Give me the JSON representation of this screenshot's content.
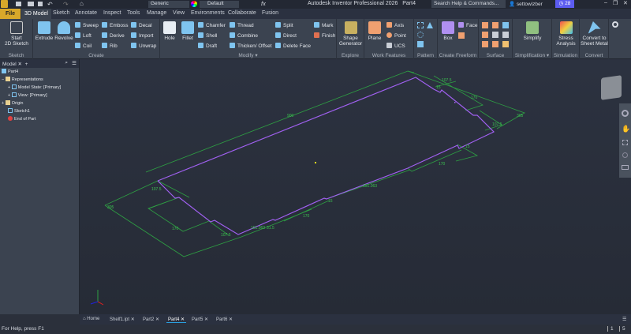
{
  "app": {
    "title": "Autodesk Inventor Professional 2026",
    "document": "Part4",
    "search_placeholder": "Search Help & Commands...",
    "user": "settowizber",
    "trial_days": "28",
    "appearance": "Generic",
    "material": "Default",
    "fx": "fx"
  },
  "tabs": [
    "File",
    "3D Model",
    "Sketch",
    "Annotate",
    "Inspect",
    "Tools",
    "Manage",
    "View",
    "Environments",
    "Collaborate",
    "Fusion"
  ],
  "ribbon": {
    "sketch": {
      "label": "Sketch",
      "start": "Start",
      "start2": "2D Sketch"
    },
    "create": {
      "label": "Create",
      "extrude": "Extrude",
      "revolve": "Revolve",
      "sweep": "Sweep",
      "loft": "Loft",
      "coil": "Coil",
      "emboss": "Emboss",
      "derive": "Derive",
      "rib": "Rib",
      "decal": "Decal",
      "import": "Import",
      "unwrap": "Unwrap"
    },
    "modify": {
      "label": "Modify ▾",
      "hole": "Hole",
      "fillet": "Fillet",
      "chamfer": "Chamfer",
      "shell": "Shell",
      "draft": "Draft",
      "thread": "Thread",
      "combine": "Combine",
      "thicken": "Thicken/ Offset",
      "split": "Split",
      "direct": "Direct",
      "delete_face": "Delete Face",
      "mark": "Mark",
      "finish": "Finish"
    },
    "explore": {
      "label": "Explore",
      "shape": "Shape",
      "generator": "Generator"
    },
    "work": {
      "label": "Work Features",
      "plane": "Plane",
      "axis": "Axis",
      "point": "Point",
      "ucs": "UCS"
    },
    "pattern": {
      "label": "Pattern"
    },
    "freeform": {
      "label": "Create Freeform",
      "box": "Box",
      "face": "Face"
    },
    "surface": {
      "label": "Surface"
    },
    "simplification": {
      "label": "Simplification ▾",
      "simplify": "Simplify"
    },
    "simulation": {
      "label": "Simulation",
      "stress": "Stress",
      "analysis": "Analysis"
    },
    "convert": {
      "label": "Convert",
      "c1": "Convert to",
      "c2": "Sheet Metal"
    }
  },
  "browser": {
    "tab": "Model",
    "items": [
      "Part4",
      "Representations",
      "Model State: [Primary]",
      "View: [Primary]",
      "Origin",
      "Sketch1",
      "End of Part"
    ]
  },
  "sketch_dims": [
    "900",
    "107.5",
    "15",
    "170",
    "305",
    "107.5",
    "15",
    "170",
    "151.063",
    "170",
    "15",
    "107.5",
    "305",
    "170",
    "107.5",
    "151.063",
    "31.5"
  ],
  "doc_tabs": [
    "Home",
    "Shelf1.ipt",
    "Part2",
    "Part4",
    "Part5",
    "Part6"
  ],
  "active_doc_tab": "Part4",
  "status": {
    "help": "For Help, press F1",
    "n1": "1",
    "n2": "5"
  },
  "colors": {
    "profile": "#a060f0",
    "dimension": "#2ea043",
    "accent": "#d8a82a"
  }
}
